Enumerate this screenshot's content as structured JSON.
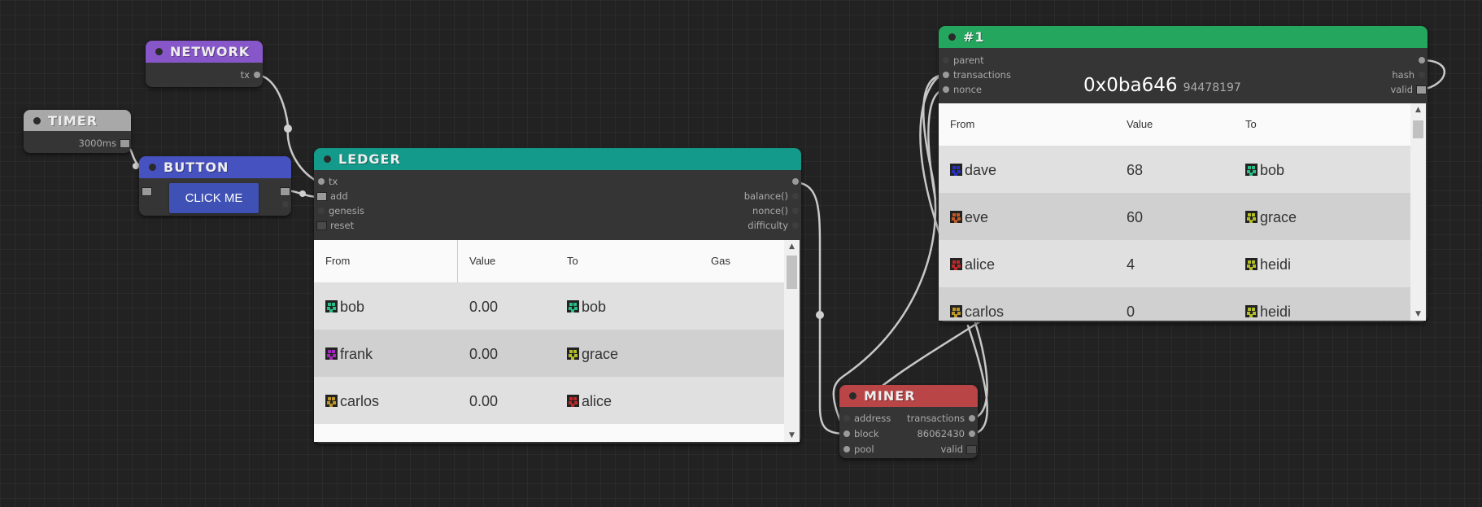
{
  "colors": {
    "network": "#8757c9",
    "timer": "#a8a8a8",
    "button": "#4652c0",
    "ledger": "#149a8a",
    "block": "#24a65e",
    "miner": "#b94547",
    "click_button": "#3f51b5"
  },
  "network": {
    "title": "NETWORK",
    "out_tx": "tx"
  },
  "timer": {
    "title": "TIMER",
    "out_interval": "3000ms"
  },
  "button_node": {
    "title": "BUTTON",
    "button_label": "CLICK ME"
  },
  "ledger": {
    "title": "LEDGER",
    "inputs": {
      "tx": "tx",
      "add": "add",
      "genesis": "genesis",
      "reset": "reset"
    },
    "outputs": {
      "balance": "balance()",
      "nonce": "nonce()",
      "difficulty": "difficulty"
    },
    "columns": {
      "from": "From",
      "value": "Value",
      "to": "To",
      "gas": "Gas"
    },
    "rows": [
      {
        "from": "bob",
        "value": "0.00",
        "to": "bob",
        "gas": ""
      },
      {
        "from": "frank",
        "value": "0.00",
        "to": "grace",
        "gas": ""
      },
      {
        "from": "carlos",
        "value": "0.00",
        "to": "alice",
        "gas": ""
      }
    ]
  },
  "block": {
    "title": "#1",
    "inputs": {
      "parent": "parent",
      "transactions": "transactions",
      "nonce": "nonce"
    },
    "outputs": {
      "hash": "hash",
      "valid": "valid"
    },
    "hash_display": "0x0ba646",
    "nonce_display": "94478197",
    "columns": {
      "from": "From",
      "value": "Value",
      "to": "To"
    },
    "rows": [
      {
        "from": "dave",
        "value": "68",
        "to": "bob"
      },
      {
        "from": "eve",
        "value": "60",
        "to": "grace"
      },
      {
        "from": "alice",
        "value": "4",
        "to": "heidi"
      },
      {
        "from": "carlos",
        "value": "0",
        "to": "heidi"
      }
    ]
  },
  "miner": {
    "title": "MINER",
    "inputs": {
      "address": "address",
      "block": "block",
      "pool": "pool"
    },
    "outputs": {
      "transactions": "transactions",
      "nonce_value": "86062430",
      "valid": "valid"
    }
  }
}
